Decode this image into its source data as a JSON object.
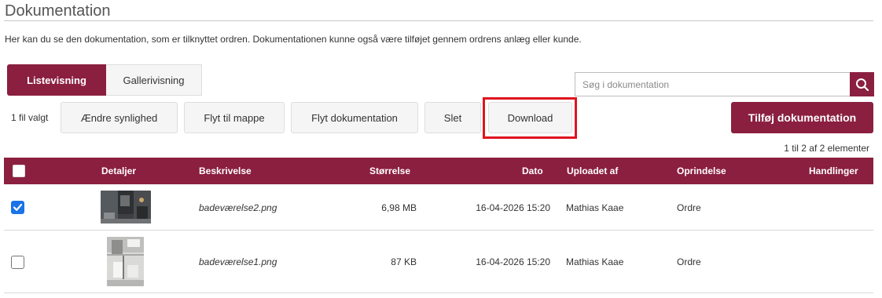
{
  "page": {
    "title": "Dokumentation",
    "intro": "Her kan du se den dokumentation, som er tilknyttet ordren. Dokumentationen kunne også være tilføjet gennem ordrens anlæg eller kunde."
  },
  "tabs": [
    {
      "label": "Listevisning",
      "active": true
    },
    {
      "label": "Gallerivisning",
      "active": false
    }
  ],
  "search": {
    "placeholder": "Søg i dokumentation",
    "icon": "search-icon"
  },
  "toolbar": {
    "selected_count": "1 fil valgt",
    "buttons": [
      "Ændre synlighed",
      "Flyt til mappe",
      "Flyt dokumentation",
      "Slet",
      "Download"
    ],
    "add_label": "Tilføj dokumentation"
  },
  "pager": "1 til 2 af 2 elementer",
  "table": {
    "columns": [
      "Detaljer",
      "Beskrivelse",
      "Størrelse",
      "Dato",
      "Uploadet af",
      "Oprindelse",
      "Handlinger"
    ],
    "rows": [
      {
        "checked": true,
        "thumbnail": "bathroom-photo-dark",
        "description": "badeværelse2.png",
        "size": "6,98 MB",
        "date": "16-04-2026 15:20",
        "uploaded_by": "Mathias Kaae",
        "origin": "Ordre"
      },
      {
        "checked": false,
        "thumbnail": "bathroom-photo-light",
        "description": "badeværelse1.png",
        "size": "87 KB",
        "date": "16-04-2026 15:20",
        "uploaded_by": "Mathias Kaae",
        "origin": "Ordre"
      }
    ]
  },
  "colors": {
    "brand": "#8b1f40",
    "highlight": "#e0141e",
    "checkbox": "#1a73e8"
  }
}
